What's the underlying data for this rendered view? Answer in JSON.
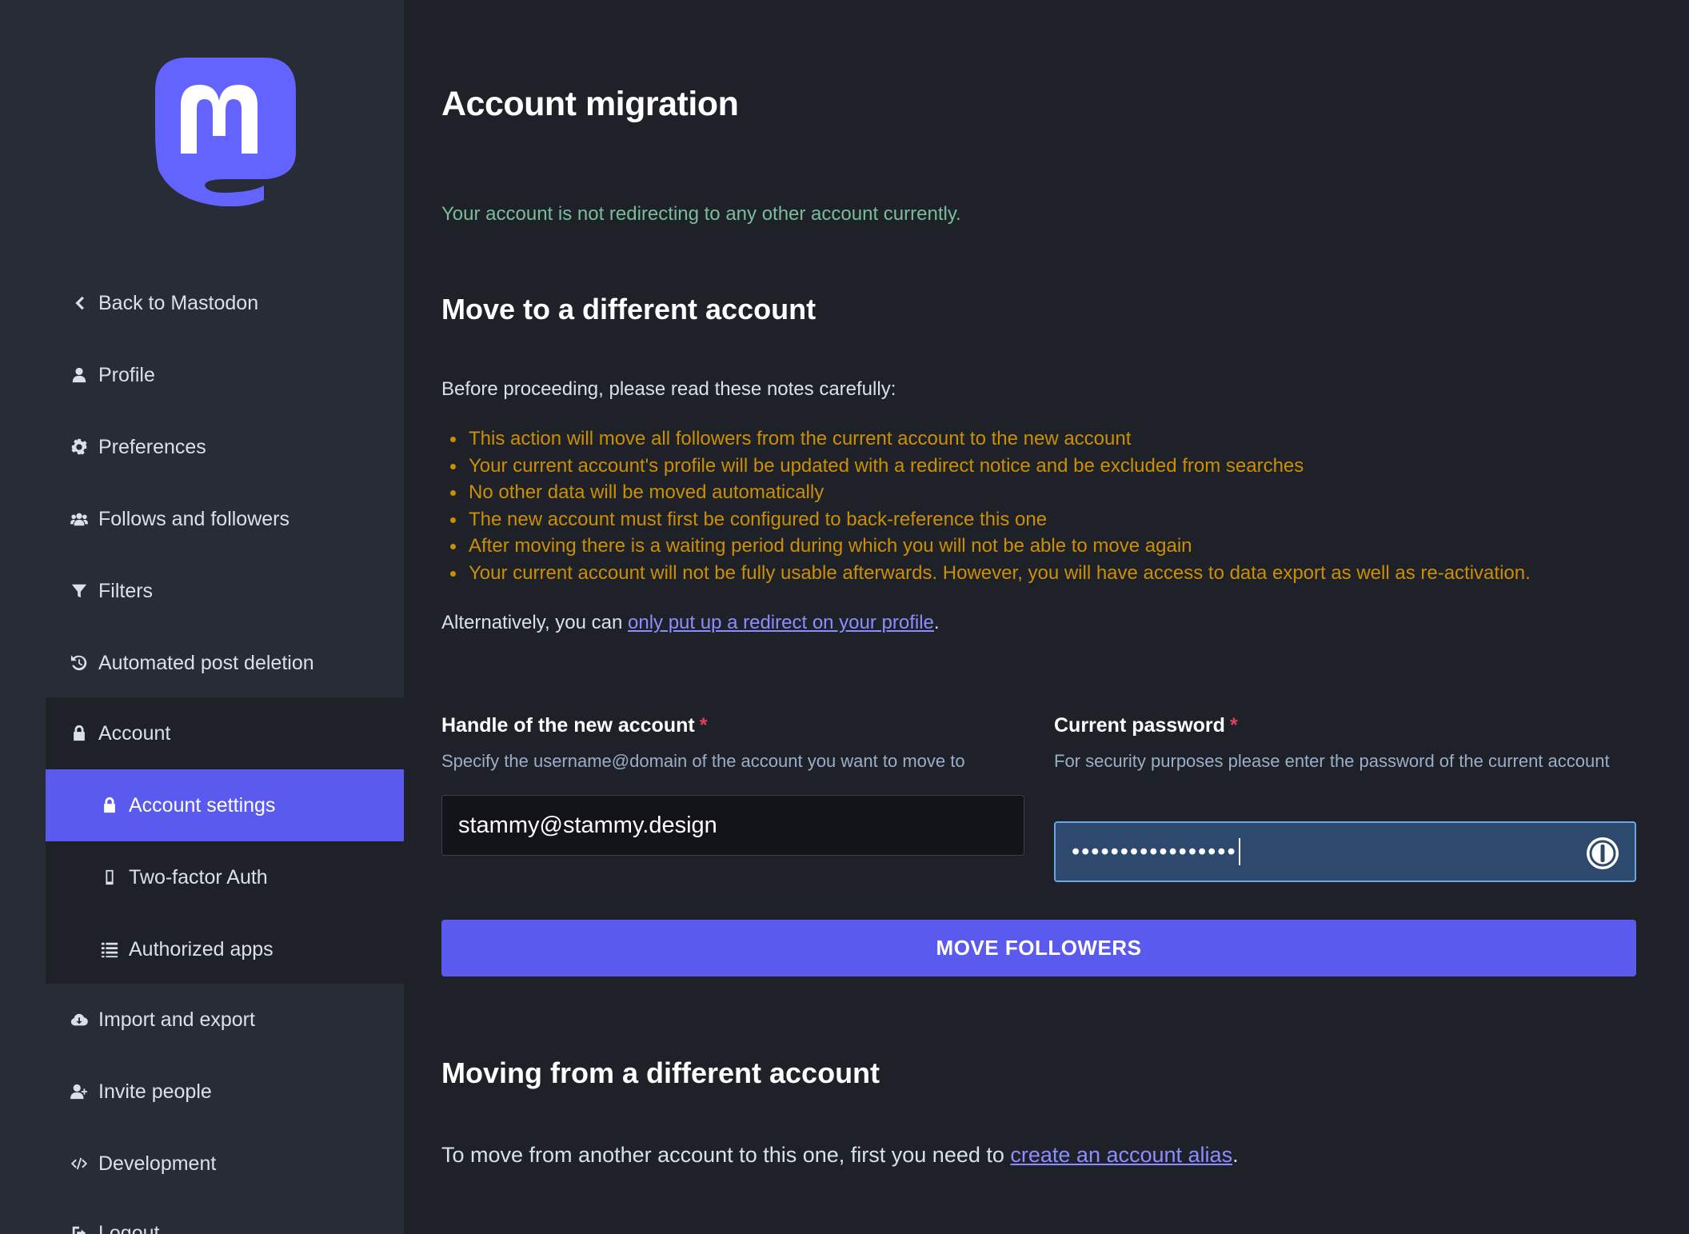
{
  "sidebar": {
    "items": [
      {
        "label": "Back to Mastodon",
        "icon": "chevron-left-icon"
      },
      {
        "label": "Profile",
        "icon": "user-icon"
      },
      {
        "label": "Preferences",
        "icon": "gear-icon"
      },
      {
        "label": "Follows and followers",
        "icon": "users-icon"
      },
      {
        "label": "Filters",
        "icon": "filter-icon"
      },
      {
        "label": "Automated post deletion",
        "icon": "history-icon"
      },
      {
        "label": "Account",
        "icon": "lock-icon"
      },
      {
        "label": "Account settings",
        "icon": "lock-icon"
      },
      {
        "label": "Two-factor Auth",
        "icon": "mobile-icon"
      },
      {
        "label": "Authorized apps",
        "icon": "list-icon"
      },
      {
        "label": "Import and export",
        "icon": "cloud-download-icon"
      },
      {
        "label": "Invite people",
        "icon": "user-plus-icon"
      },
      {
        "label": "Development",
        "icon": "code-icon"
      },
      {
        "label": "Logout",
        "icon": "sign-out-icon"
      }
    ],
    "active_item": "Account settings"
  },
  "main": {
    "title": "Account migration",
    "status": "Your account is not redirecting to any other account currently.",
    "move_section": {
      "heading": "Move to a different account",
      "intro": "Before proceeding, please read these notes carefully:",
      "warnings": [
        "This action will move all followers from the current account to the new account",
        "Your current account's profile will be updated with a redirect notice and be excluded from searches",
        "No other data will be moved automatically",
        "The new account must first be configured to back-reference this one",
        "After moving there is a waiting period during which you will not be able to move again",
        "Your current account will not be fully usable afterwards. However, you will have access to data export as well as re-activation."
      ],
      "alternative_prefix": "Alternatively, you can ",
      "alternative_link": "only put up a redirect on your profile",
      "alternative_suffix": "."
    },
    "form": {
      "handle_label": "Handle of the new account",
      "handle_hint": "Specify the username@domain of the account you want to move to",
      "handle_value": "stammy@stammy.design",
      "password_label": "Current password",
      "password_hint": "For security purposes please enter the password of the current account",
      "password_masked": "•••••••••••••••••",
      "required_mark": "*",
      "submit_label": "MOVE FOLLOWERS"
    },
    "from_section": {
      "heading": "Moving from a different account",
      "text_prefix": "To move from another account to this one, first you need to ",
      "link": "create an account alias",
      "text_suffix": "."
    }
  },
  "colors": {
    "brand": "#5b5aef",
    "success": "#79bd9a",
    "warning": "#ca8f04",
    "link": "#8c8dff",
    "required": "#df405a"
  }
}
